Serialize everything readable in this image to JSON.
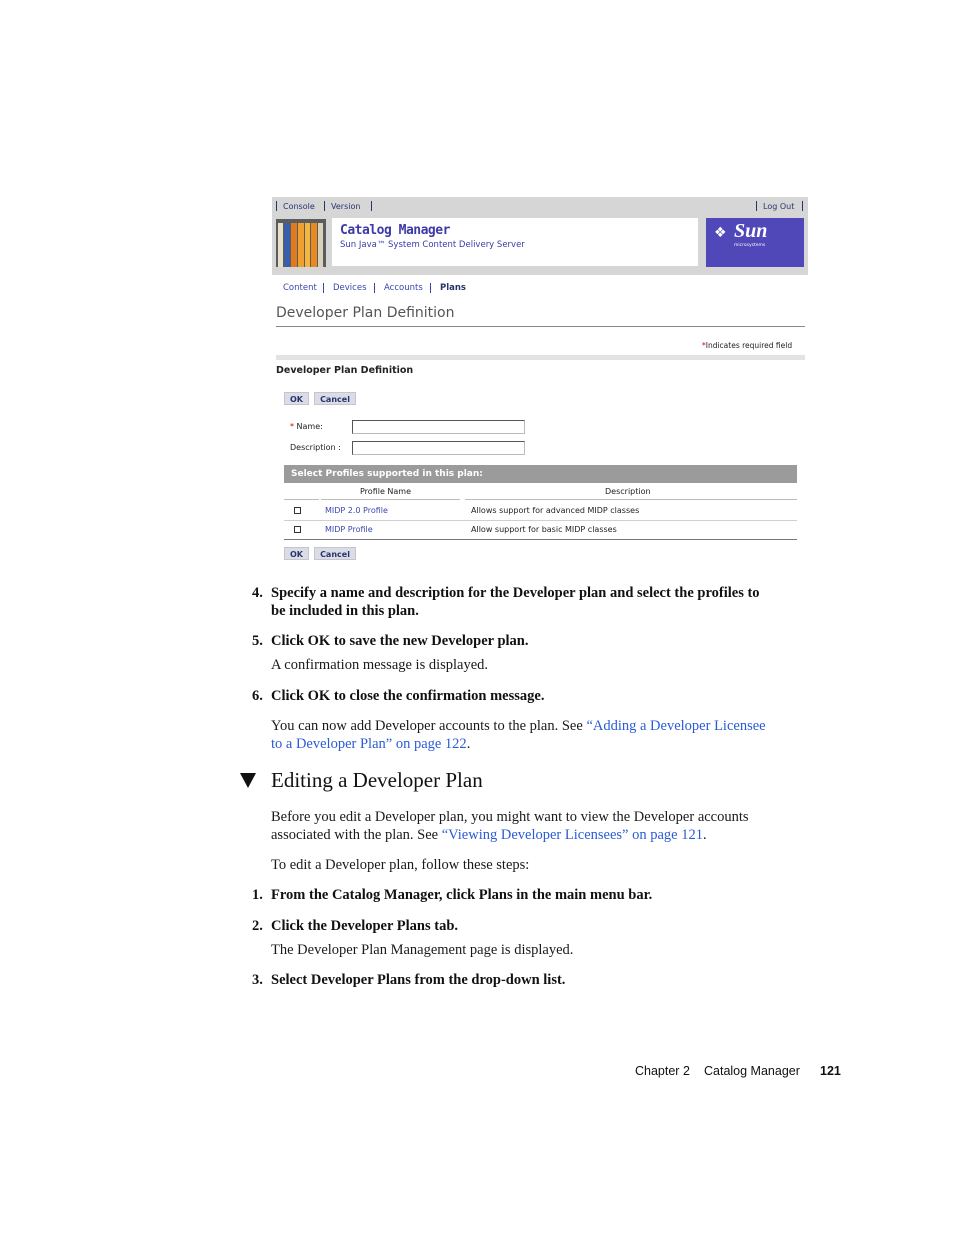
{
  "app": {
    "top_links": {
      "console": "Console",
      "version": "Version",
      "logout": "Log Out"
    },
    "brand_title": "Catalog Manager",
    "brand_subtitle": "Sun Java™ System Content Delivery Server",
    "logo_text": "Sun",
    "logo_tagline": "microsystems",
    "menu": [
      "Content",
      "Devices",
      "Accounts",
      "Plans"
    ],
    "page_title": "Developer Plan Definition",
    "required_note": "Indicates required field",
    "section_title": "Developer Plan Definition",
    "ok_label": "OK",
    "cancel_label": "Cancel",
    "name_label": "Name:",
    "description_label": "Description :",
    "name_value": "",
    "description_value": "",
    "profiles_header": "Select Profiles supported in this plan:",
    "columns": [
      "Profile Name",
      "Description"
    ],
    "profiles": [
      {
        "name": "MIDP 2.0 Profile",
        "description": "Allows support for advanced MIDP classes",
        "checked": false
      },
      {
        "name": "MIDP Profile",
        "description": "Allow support for basic MIDP classes",
        "checked": false
      }
    ],
    "colors": {
      "accent": "#3d3aa8",
      "sun_bg": "#5047b8",
      "link": "#3b46b0",
      "header_bar": "#9b9b9b"
    }
  },
  "doc": {
    "step4_num": "4.",
    "step4_line1": "Specify a name and description for the Developer plan and select the profiles to",
    "step4_line2": "be included in this plan.",
    "step5_num": "5.",
    "step5": "Click OK to save the new Developer plan.",
    "step5_result": "A confirmation message is displayed.",
    "step6_num": "6.",
    "step6": "Click OK to close the confirmation message.",
    "step6_p1_text": "You can now add Developer accounts to the plan. See ",
    "step6_p1_link_a": "“Adding a Developer Licensee",
    "step6_p1_link_b": "to a Developer Plan” on page 122",
    "step6_p1_end": ".",
    "heading": "Editing a Developer Plan",
    "intro_line1": "Before you edit a Developer plan, you might want to view the Developer accounts",
    "intro_line2_text": "associated with the plan. See ",
    "intro_link": "“Viewing Developer Licensees” on page 121",
    "intro_end": ".",
    "intro2": "To edit a Developer plan, follow these steps:",
    "s1_num": "1.",
    "s1": "From the Catalog Manager, click Plans in the main menu bar.",
    "s2_num": "2.",
    "s2": "Click the Developer Plans tab.",
    "s2_result": "The Developer Plan Management page is displayed.",
    "s3_num": "3.",
    "s3": "Select Developer Plans from the drop-down list."
  },
  "footer": {
    "chapter": "Chapter 2",
    "title": "Catalog Manager",
    "page": "121"
  }
}
